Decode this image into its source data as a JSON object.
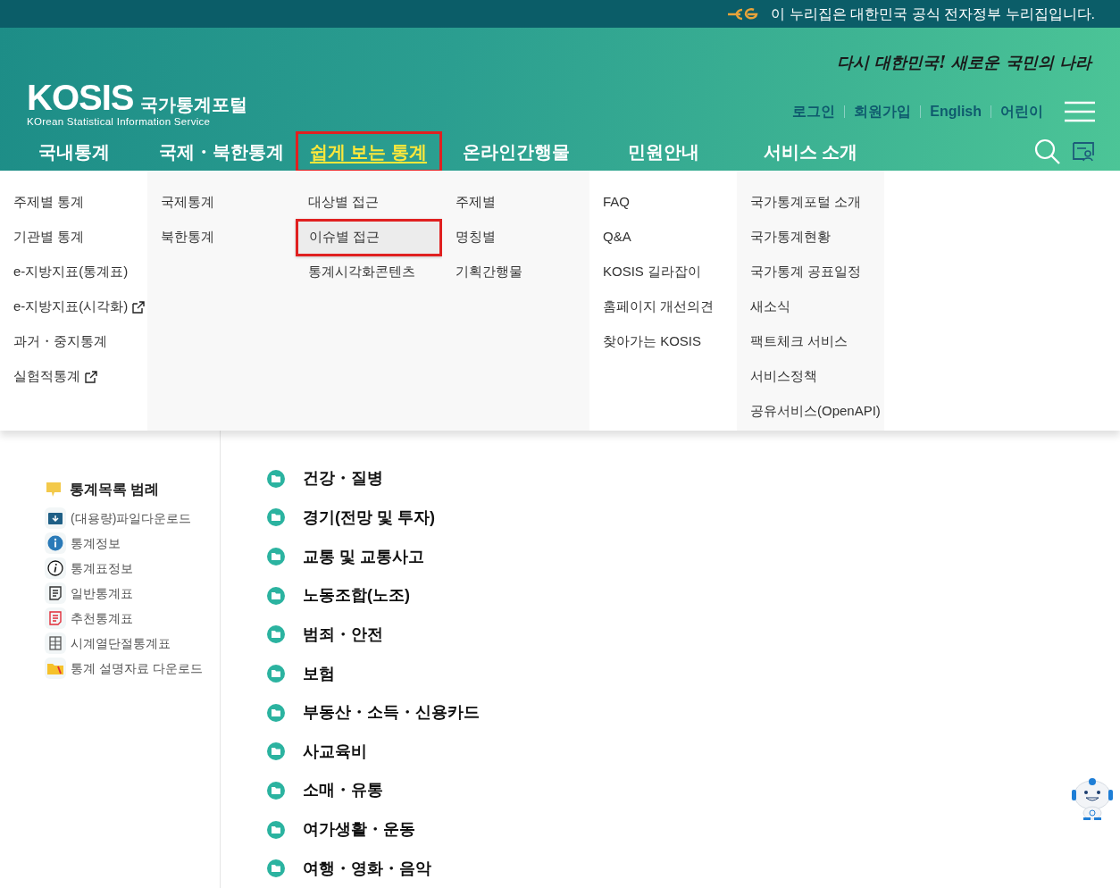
{
  "top_banner": {
    "text": "이 누리집은 대한민국 공식 전자정부 누리집입니다."
  },
  "slogan": "다시 대한민국! 새로운 국민의 나라",
  "logo": {
    "name": "KOSIS",
    "subtitle": "국가통계포털",
    "tagline": "KOrean Statistical Information Service"
  },
  "util_links": [
    "로그인",
    "회원가입",
    "English",
    "어린이"
  ],
  "menus": [
    {
      "label": "국내통계",
      "selected": false,
      "items": [
        {
          "label": "주제별 통계",
          "external": false,
          "selected": false
        },
        {
          "label": "기관별 통계",
          "external": false,
          "selected": false
        },
        {
          "label": "e-지방지표(통계표)",
          "external": false,
          "selected": false
        },
        {
          "label": "e-지방지표(시각화)",
          "external": true,
          "selected": false
        },
        {
          "label": "과거・중지통계",
          "external": false,
          "selected": false
        },
        {
          "label": "실험적통계",
          "external": true,
          "selected": false
        }
      ]
    },
    {
      "label": "국제・북한통계",
      "selected": false,
      "items": [
        {
          "label": "국제통계",
          "external": false,
          "selected": false
        },
        {
          "label": "북한통계",
          "external": false,
          "selected": false
        }
      ]
    },
    {
      "label": "쉽게 보는 통계",
      "selected": true,
      "items": [
        {
          "label": "대상별 접근",
          "external": false,
          "selected": false
        },
        {
          "label": "이슈별 접근",
          "external": false,
          "selected": true
        },
        {
          "label": "통계시각화콘텐츠",
          "external": false,
          "selected": false
        }
      ]
    },
    {
      "label": "온라인간행물",
      "selected": false,
      "items": [
        {
          "label": "주제별",
          "external": false,
          "selected": false
        },
        {
          "label": "명칭별",
          "external": false,
          "selected": false
        },
        {
          "label": "기획간행물",
          "external": false,
          "selected": false
        }
      ]
    },
    {
      "label": "민원안내",
      "selected": false,
      "items": [
        {
          "label": "FAQ",
          "external": false,
          "selected": false
        },
        {
          "label": "Q&A",
          "external": false,
          "selected": false
        },
        {
          "label": "KOSIS 길라잡이",
          "external": false,
          "selected": false
        },
        {
          "label": "홈페이지 개선의견",
          "external": false,
          "selected": false
        },
        {
          "label": "찾아가는 KOSIS",
          "external": false,
          "selected": false
        }
      ]
    },
    {
      "label": "서비스 소개",
      "selected": false,
      "items": [
        {
          "label": "국가통계포털 소개",
          "external": false,
          "selected": false
        },
        {
          "label": "국가통계현황",
          "external": false,
          "selected": false
        },
        {
          "label": "국가통계 공표일정",
          "external": false,
          "selected": false
        },
        {
          "label": "새소식",
          "external": false,
          "selected": false
        },
        {
          "label": "팩트체크 서비스",
          "external": false,
          "selected": false
        },
        {
          "label": "서비스정책",
          "external": false,
          "selected": false
        },
        {
          "label": "공유서비스(OpenAPI)",
          "external": false,
          "selected": false
        }
      ]
    }
  ],
  "legend": {
    "title": "통계목록 범례",
    "items": [
      {
        "kind": "download",
        "label": "(대용량)파일다운로드"
      },
      {
        "kind": "info",
        "label": "통계정보"
      },
      {
        "kind": "table-info",
        "label": "통계표정보"
      },
      {
        "kind": "general",
        "label": "일반통계표"
      },
      {
        "kind": "recommended",
        "label": "추천통계표"
      },
      {
        "kind": "timeseries",
        "label": "시계열단절통계표"
      },
      {
        "kind": "folder",
        "label": "통계 설명자료 다운로드"
      }
    ]
  },
  "topics": [
    "건강・질병",
    "경기(전망 및 투자)",
    "교통 및 교통사고",
    "노동조합(노조)",
    "범죄・안전",
    "보험",
    "부동산・소득・신용카드",
    "사교육비",
    "소매・유통",
    "여가생활・운동",
    "여행・영화・음악"
  ]
}
